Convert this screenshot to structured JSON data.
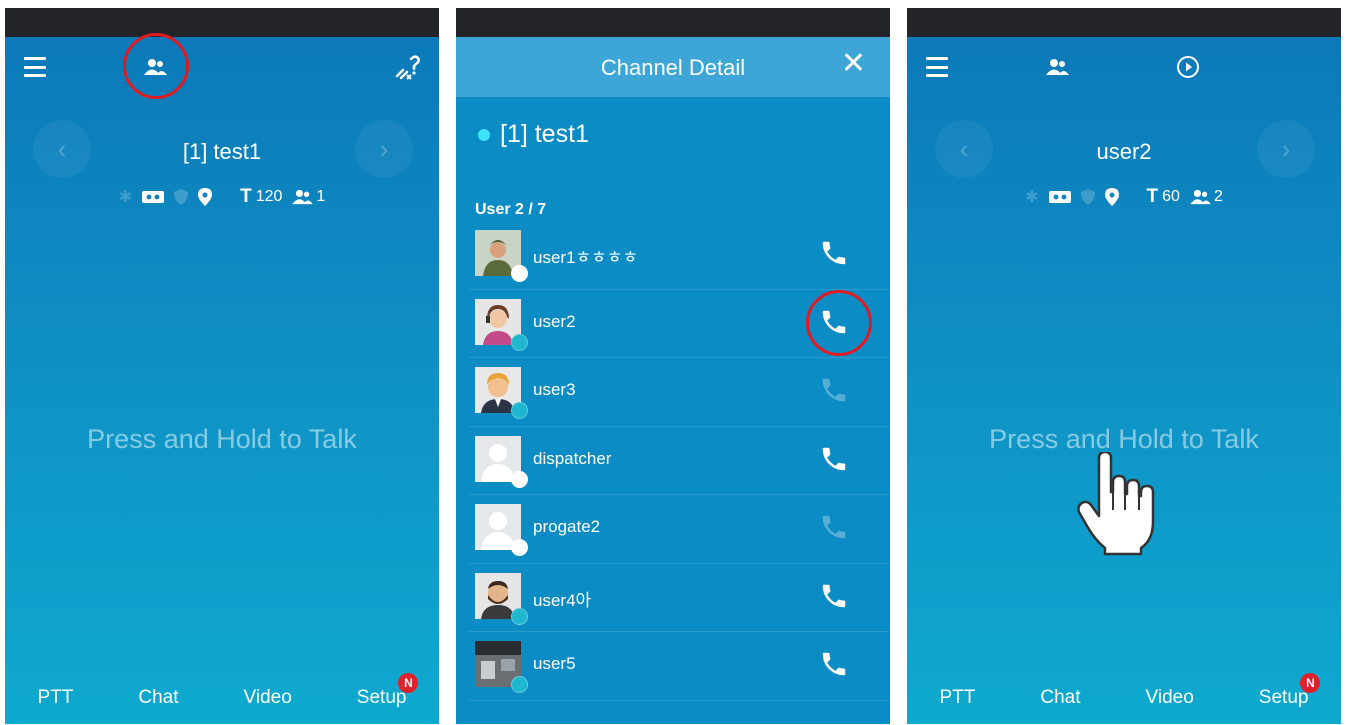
{
  "screen1": {
    "channel_title": "[1] test1",
    "timer": "120",
    "members": "1",
    "timer_glyph": "T",
    "press_label": "Press and Hold to Talk",
    "tabs": [
      "PTT",
      "Chat",
      "Video",
      "Setup"
    ],
    "badge": "N",
    "icons": [
      "menu-icon",
      "members-icon",
      "disconnected-link-icon",
      "bluetooth-icon",
      "recorder-icon",
      "shield-icon",
      "location-icon"
    ]
  },
  "screen2": {
    "header_title": "Channel Detail",
    "close_glyph": "✕",
    "channel_name": "[1] test1",
    "user_count": "User 2 / 7",
    "users": [
      {
        "name": "user1ㅎㅎㅎㅎ",
        "status_color": "#ffffff",
        "call_enabled": true
      },
      {
        "name": "user2",
        "status_color": "#1fb6d0",
        "call_enabled": true
      },
      {
        "name": "user3",
        "status_color": "#1fb6d0",
        "call_enabled": false
      },
      {
        "name": "dispatcher",
        "status_color": "#ffffff",
        "call_enabled": true
      },
      {
        "name": "progate2",
        "status_color": "#ffffff",
        "call_enabled": false
      },
      {
        "name": "user4아",
        "status_color": "#1fb6d0",
        "call_enabled": true
      },
      {
        "name": "user5",
        "status_color": "#1fb6d0",
        "call_enabled": true
      }
    ]
  },
  "screen3": {
    "channel_title": "user2",
    "timer": "60",
    "members": "2",
    "timer_glyph": "T",
    "press_label": "Press and Hold to Talk",
    "tabs": [
      "PTT",
      "Chat",
      "Video",
      "Setup"
    ],
    "badge": "N",
    "icons": [
      "menu-icon",
      "members-icon",
      "play-circle-icon",
      "hand-pointer-icon"
    ]
  },
  "colors": {
    "accent_red": "#e01b22",
    "header_blue": "#3da6d6",
    "detail_bg": "#0b8cc4",
    "online_teal": "#1fb6d0"
  }
}
